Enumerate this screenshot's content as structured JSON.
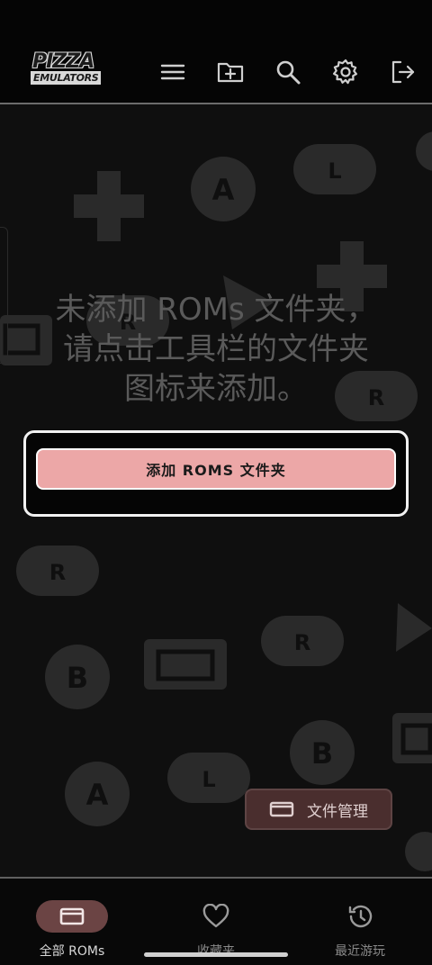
{
  "app": {
    "logo_line1": "PIZZA",
    "logo_line2": "EMULATORS"
  },
  "toolbar": {
    "icons": [
      "menu-icon",
      "add-folder-icon",
      "search-icon",
      "gear-icon",
      "logout-icon"
    ]
  },
  "empty_state": {
    "message": "未添加 ROMs 文件夹，请点击工具栏的文件夹图标来添加。"
  },
  "dialog": {
    "add_button_label": "添加 ROMS 文件夹"
  },
  "fab": {
    "label": "文件管理"
  },
  "bottom_nav": [
    {
      "label": "全部 ROMs",
      "icon": "console-icon",
      "active": true
    },
    {
      "label": "收藏夹",
      "icon": "heart-icon",
      "active": false
    },
    {
      "label": "最近游玩",
      "icon": "history-icon",
      "active": false
    }
  ],
  "colors": {
    "accent": "#eca7a7",
    "active_pill": "#6b4444",
    "fab_bg": "#4a2e2e",
    "background": "#0f0f0f"
  }
}
